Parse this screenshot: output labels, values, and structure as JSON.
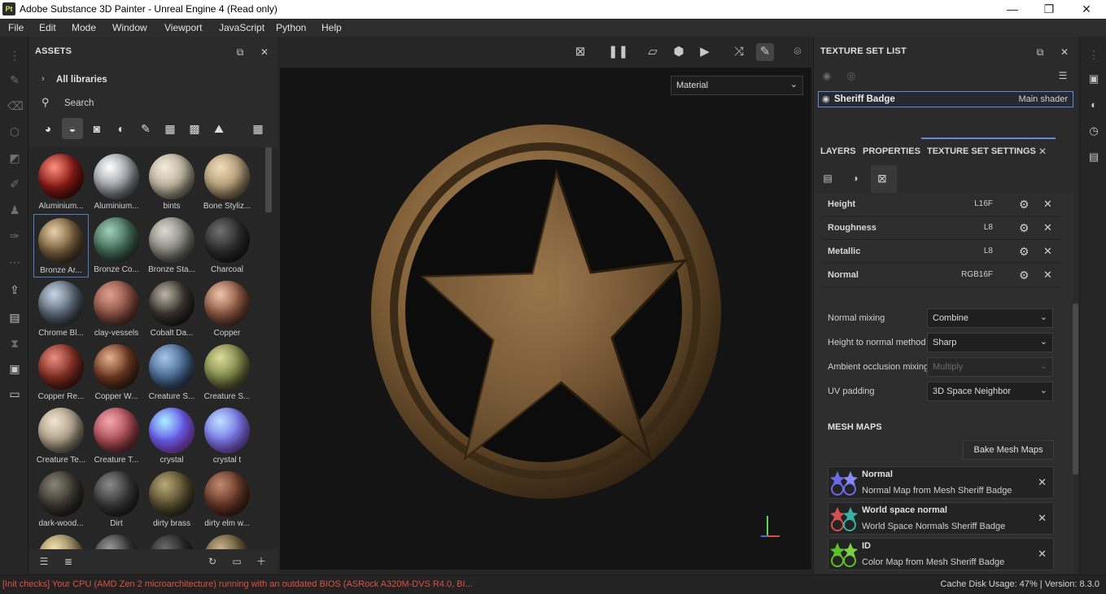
{
  "window": {
    "app_icon": "Pt",
    "title": "Adobe Substance 3D Painter - Unreal Engine 4 (Read only)",
    "minimize": "—",
    "maximize": "❐",
    "close": "✕"
  },
  "menu": [
    "File",
    "Edit",
    "Mode",
    "Window",
    "Viewport",
    "JavaScript",
    "Python",
    "Help"
  ],
  "assets": {
    "title": "ASSETS",
    "library": "All libraries",
    "search_placeholder": "Search",
    "items": [
      {
        "label": "Aluminium...",
        "color": "#8b1c17"
      },
      {
        "label": "Aluminium...",
        "color": "#9ea3a8"
      },
      {
        "label": "bints",
        "color": "#bdb49f"
      },
      {
        "label": "Bone Styliz...",
        "color": "#b7a07c"
      },
      {
        "label": "Bronze Ar...",
        "color": "#7a6040",
        "selected": true
      },
      {
        "label": "Bronze Co...",
        "color": "#466e5c"
      },
      {
        "label": "Bronze Sta...",
        "color": "#8c8c84"
      },
      {
        "label": "Charcoal",
        "color": "#2e2e2e"
      },
      {
        "label": "Chrome Bl...",
        "color": "#5c6a78"
      },
      {
        "label": "clay-vessels",
        "color": "#8f5446"
      },
      {
        "label": "Cobalt Da...",
        "color": "#3b3630"
      },
      {
        "label": "Copper",
        "color": "#8f5a44"
      },
      {
        "label": "Copper Re...",
        "color": "#852f24"
      },
      {
        "label": "Copper W...",
        "color": "#6e3a22"
      },
      {
        "label": "Creature S...",
        "color": "#4d6e98"
      },
      {
        "label": "Creature S...",
        "color": "#848c4c"
      },
      {
        "label": "Creature Te...",
        "color": "#b2a48e"
      },
      {
        "label": "Creature T...",
        "color": "#b0505a"
      },
      {
        "label": "crystal",
        "color": "#6a5ef0"
      },
      {
        "label": "crystal t",
        "color": "#7a7ae8"
      },
      {
        "label": "dark-wood...",
        "color": "#3e3a32"
      },
      {
        "label": "Dirt",
        "color": "#3a3a3a"
      },
      {
        "label": "dirty brass",
        "color": "#5e5434"
      },
      {
        "label": "dirty elm w...",
        "color": "#6a3a2a"
      }
    ]
  },
  "viewport": {
    "display_mode": "Material"
  },
  "texture_set_list": {
    "title": "TEXTURE SET LIST",
    "set_name": "Sheriff Badge",
    "shader": "Main shader"
  },
  "tabs": [
    "LAYERS",
    "PROPERTIES",
    "TEXTURE SET SETTINGS"
  ],
  "channels": [
    {
      "name": "Height",
      "format": "L16F"
    },
    {
      "name": "Roughness",
      "format": "L8"
    },
    {
      "name": "Metallic",
      "format": "L8"
    },
    {
      "name": "Normal",
      "format": "RGB16F"
    }
  ],
  "settings": [
    {
      "label": "Normal mixing",
      "value": "Combine",
      "disabled": false
    },
    {
      "label": "Height to normal method",
      "value": "Sharp",
      "disabled": false
    },
    {
      "label": "Ambient occlusion mixing",
      "value": "Multiply",
      "disabled": true
    },
    {
      "label": "UV padding",
      "value": "3D Space Neighbor",
      "disabled": false
    }
  ],
  "mesh_maps": {
    "title": "MESH MAPS",
    "bake_button": "Bake Mesh Maps",
    "items": [
      {
        "title": "Normal",
        "subtitle": "Normal Map from Mesh Sheriff Badge",
        "color": "#6a6ae8"
      },
      {
        "title": "World space normal",
        "subtitle": "World Space Normals Sheriff Badge",
        "color": "#d05050"
      },
      {
        "title": "ID",
        "subtitle": "Color Map from Mesh Sheriff Badge",
        "color": "#5cc02a"
      }
    ]
  },
  "status": {
    "error": "[Init checks] Your CPU (AMD Zen 2 microarchitecture) running with an outdated BIOS (ASRock A320M-DVS R4.0, BI...",
    "cache": "Cache Disk Usage:   47% | Version: 8.3.0"
  }
}
